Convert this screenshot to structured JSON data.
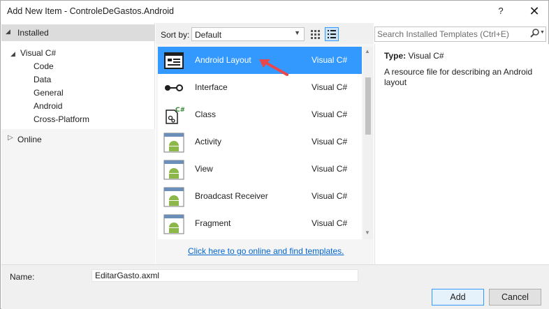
{
  "window": {
    "title": "Add New Item - ControleDeGastos.Android",
    "help": "?",
    "close": "✕"
  },
  "sidebar": {
    "installed_label": "Installed",
    "root_label": "Visual C#",
    "children": [
      "Code",
      "Data",
      "General",
      "Android",
      "Cross-Platform"
    ],
    "online_label": "Online"
  },
  "toolbar": {
    "sort_label": "Sort by:",
    "sort_value": "Default"
  },
  "search": {
    "placeholder": "Search Installed Templates (Ctrl+E)"
  },
  "templates": [
    {
      "name": "Android Layout",
      "lang": "Visual C#",
      "icon": "layout-icon",
      "selected": true
    },
    {
      "name": "Interface",
      "lang": "Visual C#",
      "icon": "interface-icon"
    },
    {
      "name": "Class",
      "lang": "Visual C#",
      "icon": "class-icon"
    },
    {
      "name": "Activity",
      "lang": "Visual C#",
      "icon": "android-icon"
    },
    {
      "name": "View",
      "lang": "Visual C#",
      "icon": "android-icon"
    },
    {
      "name": "Broadcast Receiver",
      "lang": "Visual C#",
      "icon": "android-icon"
    },
    {
      "name": "Fragment",
      "lang": "Visual C#",
      "icon": "android-icon"
    }
  ],
  "online_link": "Click here to go online and find templates.",
  "details": {
    "type_label": "Type:",
    "type_value": "Visual C#",
    "description": "A resource file for describing an Android layout"
  },
  "footer": {
    "name_label": "Name:",
    "name_value": "EditarGasto.axml",
    "add_label": "Add",
    "cancel_label": "Cancel"
  },
  "colors": {
    "selection": "#3399ff",
    "link": "#0066cc",
    "android_green": "#8cb84a",
    "annotation_arrow": "#e8474c"
  }
}
